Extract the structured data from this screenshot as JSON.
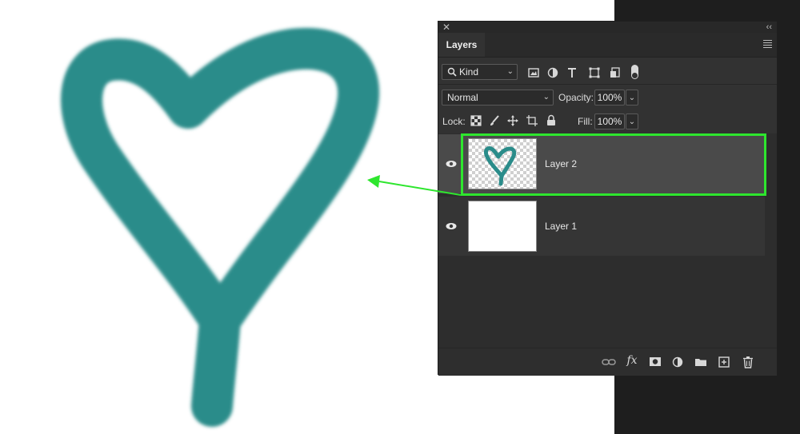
{
  "panel": {
    "tab_label": "Layers",
    "filter": {
      "kind_label": "Kind"
    },
    "blend": {
      "mode": "Normal",
      "opacity_label": "Opacity:",
      "opacity_value": "100%"
    },
    "lock": {
      "lock_label": "Lock:",
      "fill_label": "Fill:",
      "fill_value": "100%"
    },
    "layers": [
      {
        "name": "Layer 2",
        "selected": true
      },
      {
        "name": "Layer 1",
        "selected": false
      }
    ]
  },
  "colors": {
    "heart": "#2a8c8a",
    "highlight": "#2ee62e",
    "panel_bg": "#323232"
  },
  "icons": {
    "filter": [
      "image-icon",
      "adjustment-icon",
      "type-icon",
      "shape-icon",
      "smart-object-icon"
    ],
    "lock": [
      "lock-transparent-icon",
      "lock-paint-icon",
      "lock-move-icon",
      "lock-artboard-icon",
      "lock-all-icon"
    ],
    "bottom": [
      "link-icon",
      "fx-icon",
      "mask-icon",
      "adjustment-layer-icon",
      "folder-icon",
      "new-layer-icon",
      "trash-icon"
    ]
  }
}
